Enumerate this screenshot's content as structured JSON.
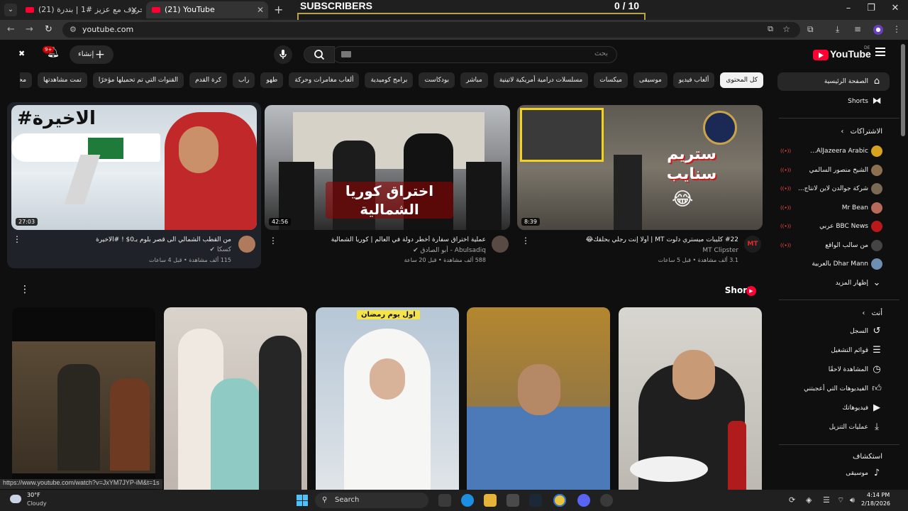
{
  "browser": {
    "tabs": [
      {
        "title": "(21) حروف مع عزيز #1 | بندرة"
      },
      {
        "title": "(21) YouTube"
      }
    ],
    "url": "youtube.com",
    "status_url": "https://www.youtube.com/watch?v=JxYM7JYP-iM&t=1s"
  },
  "overlay": {
    "label": "SUBSCRIBERS",
    "counter": "0  / 10",
    "progress": 0.0
  },
  "header": {
    "logo_text": "YouTube",
    "logo_country": "DE",
    "search_placeholder": "بحث",
    "create_label": "إنشاء",
    "notifications_badge": "9+"
  },
  "chips": [
    {
      "label": "كل المحتوى",
      "active": true
    },
    {
      "label": "ألعاب فيديو"
    },
    {
      "label": "موسيقى"
    },
    {
      "label": "ميكسات"
    },
    {
      "label": "مسلسلات درامية أمريكية لاتينية"
    },
    {
      "label": "مباشر"
    },
    {
      "label": "بودكاست"
    },
    {
      "label": "برامج كوميدية"
    },
    {
      "label": "ألعاب مغامرات وحركة"
    },
    {
      "label": "طهو"
    },
    {
      "label": "راب"
    },
    {
      "label": "كرة القدم"
    },
    {
      "label": "القنوات التي تم تحميلها مؤخرًا"
    },
    {
      "label": "تمت مشاهدتها"
    },
    {
      "label": "محتوى جديد لك"
    }
  ],
  "sidebar": {
    "main": [
      {
        "label": "الصفحة الرئيسية",
        "icon": "home-icon"
      },
      {
        "label": "Shorts",
        "icon": "shorts-icon"
      }
    ],
    "subscriptions_title": "الاشتراكات",
    "subscriptions": [
      {
        "label": "AlJazeera Arabic...",
        "color": "#d8a21f"
      },
      {
        "label": "الشيخ منصور السالمي",
        "color": "#8b6f4e"
      },
      {
        "label": "شركة جوالدن لاين لانتاج...",
        "color": "#7a6a55"
      },
      {
        "label": "Mr Bean",
        "color": "#b56a5a"
      },
      {
        "label": "BBC News عربي",
        "color": "#bb1919"
      },
      {
        "label": "من سالب الواقع",
        "color": "#444444"
      },
      {
        "label": "Dhar Mann بالعربية",
        "color": "#6f8fb0"
      }
    ],
    "show_more": "إظهار المزيد",
    "you_title": "أنت",
    "you_items": [
      {
        "label": "السجل",
        "icon": "history-icon"
      },
      {
        "label": "قوائم التشغيل",
        "icon": "playlist-icon"
      },
      {
        "label": "المشاهدة لاحقًا",
        "icon": "clock-icon"
      },
      {
        "label": "الفيديوهات التي أعجبتني",
        "icon": "like-icon"
      },
      {
        "label": "فيديوهاتك",
        "icon": "your-videos-icon"
      },
      {
        "label": "عمليات التنزيل",
        "icon": "download-icon"
      }
    ],
    "explore_title": "استكشاف",
    "explore_items": [
      {
        "label": "موسيقى",
        "icon": "music-icon"
      }
    ]
  },
  "videos": [
    {
      "title": "من القطب الشمالي الى قصر بلوم بـ0$ ! #الاخيرة",
      "channel": "كسكا",
      "meta": "115 ألف مشاهدة • قبل 4 ساعات",
      "duration": "27:03",
      "thumb_text": "#الاخيرة"
    },
    {
      "title": "عملية اختراق سفارة أخطر دولة في العالم | كوريا الشمالية",
      "channel": "Abulsadiq - أبو الصادق",
      "meta": "588 ألف مشاهدة • قبل 20 ساعة",
      "duration": "42:56",
      "thumb_text": "اختراق كوريا الشمالية"
    },
    {
      "title": "#22 كليبات ميستري دلوت MT | أولا إنت رجلي بحلقك😂",
      "channel": "MT Clipster",
      "meta": "3.1 ألف مشاهدة • قبل 5 ساعات",
      "duration": "8:39",
      "thumb_text": "ستريم سنايب"
    }
  ],
  "shorts": {
    "title": "Shorts",
    "items": [
      {
        "caption": ""
      },
      {
        "caption": ""
      },
      {
        "caption": "اول يوم رمضان"
      },
      {
        "caption": ""
      },
      {
        "caption": ""
      }
    ]
  },
  "taskbar": {
    "weather_temp": "30°F",
    "weather_desc": "Cloudy",
    "search_label": "Search",
    "time": "4:14 PM",
    "date": "2/18/2026"
  }
}
